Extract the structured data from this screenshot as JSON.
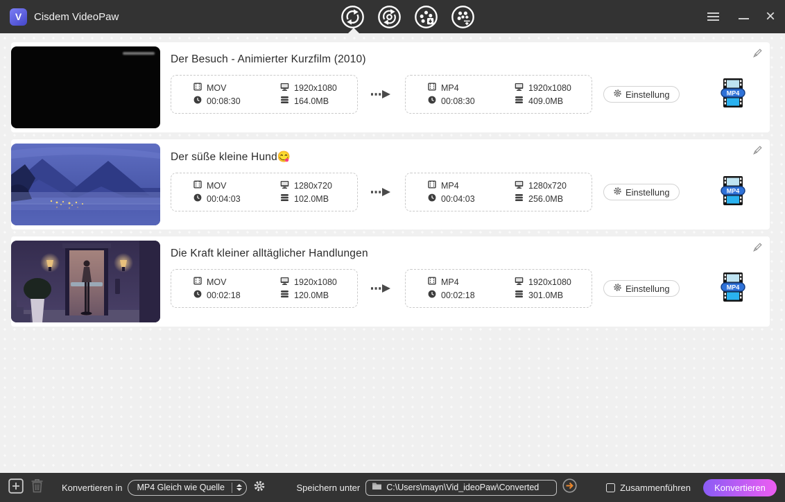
{
  "window": {
    "app_title": "Cisdem VideoPaw",
    "tabs": [
      {
        "name": "convert"
      },
      {
        "name": "rip"
      },
      {
        "name": "download"
      },
      {
        "name": "toolbox"
      }
    ]
  },
  "colors": {
    "titlebar": "#333333",
    "logo_accent": "#5a5ee8",
    "output_icon_blue": "#2ab2f0",
    "go_arrow_orange": "#e8862d",
    "convert_gradient_start": "#8a5cf5",
    "convert_gradient_end": "#ee5df2"
  },
  "rows": [
    {
      "title": "Der Besuch - Animierter Kurzfilm (2010)",
      "source": {
        "format": "MOV",
        "duration": "00:08:30",
        "resolution": "1920x1080",
        "size": "164.0MB"
      },
      "target": {
        "format": "MP4",
        "duration": "00:08:30",
        "resolution": "1920x1080",
        "size": "409.0MB"
      },
      "settings_label": "Einstellung",
      "thumbnail": "black-frame-with-small-credit-text"
    },
    {
      "title": "Der süße kleine Hund😋",
      "source": {
        "format": "MOV",
        "duration": "00:04:03",
        "resolution": "1280x720",
        "size": "102.0MB"
      },
      "target": {
        "format": "MP4",
        "duration": "00:04:03",
        "resolution": "1280x720",
        "size": "256.0MB"
      },
      "settings_label": "Einstellung",
      "thumbnail": "blue-misty-mountains-at-dusk"
    },
    {
      "title": "Die Kraft kleiner alltäglicher Handlungen",
      "source": {
        "format": "MOV",
        "duration": "00:02:18",
        "resolution": "1920x1080",
        "size": "120.0MB"
      },
      "target": {
        "format": "MP4",
        "duration": "00:02:18",
        "resolution": "1920x1080",
        "size": "301.0MB"
      },
      "settings_label": "Einstellung",
      "thumbnail": "man-standing-in-lit-doorway"
    }
  ],
  "footer": {
    "convert_in_label": "Konvertieren in",
    "format_selected": "MP4 Gleich wie Quelle",
    "save_under_label": "Speichern unter",
    "output_path": "C:\\Users\\mayn\\Vid_ideoPaw\\Converted",
    "merge_label": "Zusammenführen",
    "convert_button_label": "Konvertieren"
  }
}
